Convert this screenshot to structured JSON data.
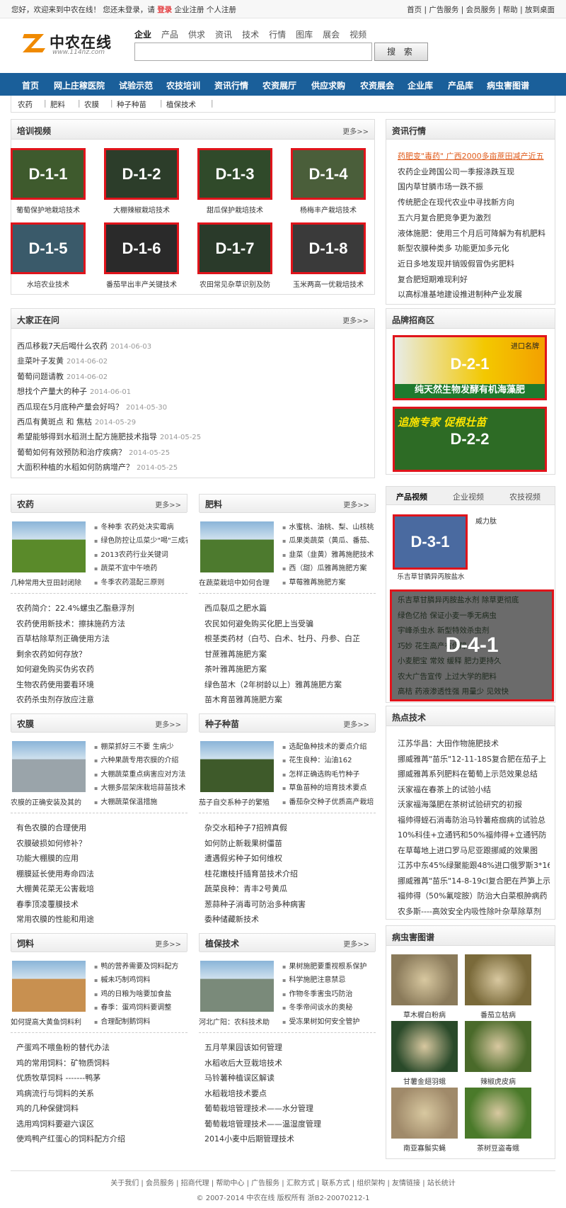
{
  "topbar": {
    "welcome": "您好，欢迎来到中农在线！ 您还未登录，请",
    "login": "登录",
    "links_left": "企业注册  个人注册",
    "links_right": "首页 | 广告服务 | 会员服务 | 帮助 | 放到桌面"
  },
  "logo": {
    "name": "中农在线",
    "url": "www.114nz.com"
  },
  "search": {
    "tabs": [
      "企业",
      "产品",
      "供求",
      "资讯",
      "技术",
      "行情",
      "图库",
      "展会",
      "视频"
    ],
    "value": "",
    "button": "搜 索"
  },
  "nav": [
    "首页",
    "网上庄稼医院",
    "试验示范",
    "农技培训",
    "资讯行情",
    "农资展厅",
    "供应求购",
    "农资展会",
    "企业库",
    "产品库",
    "病虫害图谱"
  ],
  "subnav": [
    "农药",
    "|",
    "肥料",
    "|",
    "农膜",
    "|",
    "种子种苗",
    "|",
    "植保技术",
    "|"
  ],
  "more": "更多>>",
  "training": {
    "title": "培训视频",
    "items": [
      {
        "label": "D-1-1",
        "caption": "葡萄保护地栽培技术"
      },
      {
        "label": "D-1-2",
        "caption": "大棚辣椒栽培技术"
      },
      {
        "label": "D-1-3",
        "caption": "甜瓜保护栽培技术"
      },
      {
        "label": "D-1-4",
        "caption": "杨梅丰产栽培技术"
      },
      {
        "label": "D-1-5",
        "caption": "水培农业技术"
      },
      {
        "label": "D-1-6",
        "caption": "番茄早出丰产关键技术"
      },
      {
        "label": "D-1-7",
        "caption": "农田常见杂草识别及防"
      },
      {
        "label": "D-1-8",
        "caption": "玉米两高一优栽培技术"
      }
    ]
  },
  "news": {
    "title": "资讯行情",
    "items": [
      "药肥变\"毒药\" 广西2000多亩蔗田减产近五",
      "农药企业跨国公司一季报涤跌互现",
      "国内草甘膦市场一跌不振",
      "传统肥企在现代农业中寻找新方向",
      "五六月复合肥竞争更为激烈",
      "液体施肥：使用三个月后可降解为有机肥料",
      "新型农膜种类多 功能更加多元化",
      "近日多地发现并销毁假冒伪劣肥料",
      "复合肥短期难现利好",
      "以高标准基地建设推进制种产业发展"
    ]
  },
  "asking": {
    "title": "大家正在问",
    "items": [
      {
        "q": "西瓜移栽7天后喝什么农药",
        "d": "2014-06-03"
      },
      {
        "q": "韭菜叶子发黄",
        "d": "2014-06-02"
      },
      {
        "q": "葡萄问题请教",
        "d": "2014-06-02"
      },
      {
        "q": "想找个产量大的种子",
        "d": "2014-06-01"
      },
      {
        "q": "西瓜现在5月底种产量会好吗？",
        "d": "2014-05-30"
      },
      {
        "q": "西瓜有黄斑点 和 焦枯",
        "d": "2014-05-29"
      },
      {
        "q": "希望能够得到水稻测土配方施肥技术指导",
        "d": "2014-05-25"
      },
      {
        "q": "葡萄如何有效预防和治疗疾病？",
        "d": "2014-05-25"
      },
      {
        "q": "大面积种植的水稻如何防病增产？",
        "d": "2014-05-25"
      }
    ]
  },
  "brand": {
    "title": "品牌招商区",
    "ads": [
      {
        "label": "D-2-1",
        "text": "纯天然生物发酵有机海藻肥",
        "tag": "进口名牌"
      },
      {
        "label": "D-2-2",
        "text": "追施专家 促根壮苗"
      }
    ]
  },
  "product_video": {
    "tabs": [
      "产品视频",
      "企业视频",
      "农技视频"
    ],
    "thumb": {
      "label": "D-3-1",
      "caption": "乐吉草甘膦异丙胺盐水",
      "side": "威力肽"
    },
    "list": {
      "label": "D-4-1",
      "items": [
        "乐吉草甘膦异丙胺盐水剂 除草更彻底",
        "绿色亿拾 保证小麦一季无病虫",
        "宇峰杀虫水 新型特效杀虫剂",
        "巧妙 花生高产有保障",
        "小麦肥宝 常效 缓释 肥力更持久",
        "农大广告宣传 上过大学的肥料",
        "高桔 药液渗透性强 用量少 见效快"
      ]
    }
  },
  "pesticide": {
    "title": "农药",
    "img_caption": "几种常用大豆田封闭除",
    "bullets": [
      "冬种季 农药处决实霉病",
      "绿色防控让瓜菜少\"喝\"三成农",
      "2013农药行业关键词",
      "蔬菜不宜中午喷药",
      "冬季农药混配三原则"
    ],
    "items": [
      "农药简介：22.4%螺虫乙酯悬浮剂",
      "农药使用新技术：擦抹施药方法",
      "百草枯除草剂正确使用方法",
      "剩余农药如何存放？",
      "如何避免购买伪劣农药",
      "生物农药使用要看环境",
      "农药杀虫剂存放应注意"
    ]
  },
  "fertilizer": {
    "title": "肥料",
    "img_caption": "在蔬菜栽培中如何合理",
    "bullets": [
      "水蜜桃、油桃、梨、山核桃",
      "瓜果类蔬菜（黄瓜、番茄、",
      "韭菜（韭黄）雅苒施肥技术",
      "西（甜）瓜雅苒施肥方案",
      "草莓雅苒施肥方案"
    ],
    "items": [
      "西瓜裂瓜之肥水篇",
      "农民如何避免购买化肥上当受骗",
      "根茎类药材（白芍、白术、牡丹、丹参、白芷",
      "甘蔗雅苒施肥方案",
      "茶叶雅苒施肥方案",
      "绿色苗木（2年树龄以上）雅苒施肥方案",
      "苗木育苗雅苒施肥方案"
    ]
  },
  "film": {
    "title": "农膜",
    "img_caption": "农膜的正确安装及其的",
    "bullets": [
      "棚菜抓好三不要 生病少",
      "六种果蔬专用农膜的介绍",
      "大棚蔬菜重点病害应对方法",
      "大棚多层架床栽培蒜苗技术",
      "大棚蔬菜保温措施"
    ],
    "items": [
      "有色农膜的合理使用",
      "农膜破损如何修补？",
      "功能大棚膜的应用",
      "棚膜延长使用寿命四法",
      "大棚黄花菜无公害栽培",
      "春季顶凌覆膜技术",
      "常用农膜的性能和用途"
    ]
  },
  "seed": {
    "title": "种子种苗",
    "img_caption": "茄子自交系种子的繁殖",
    "bullets": [
      "选配鱼种技术的要点介绍",
      "花生良种：汕油162",
      "怎样正确选购毛竹种子",
      "草鱼苗种的培育技术要点",
      "番茄杂交种子优质高产栽培"
    ],
    "items": [
      "杂交水稻种子7招辨真假",
      "如何防止新栽果树僵苗",
      "遭遇假劣种子如何维权",
      "桂花嫩枝扦插育苗技术介绍",
      "蔬菜良种：青丰2号黄瓜",
      "葱蒜种子消毒可防治多种病害",
      "委种储藏新技术"
    ]
  },
  "feed": {
    "title": "饲料",
    "img_caption": "如何提高大黄鱼饲料利",
    "bullets": [
      "鸭的营养需要及饲料配方",
      "槭未巧制鸡饲料",
      "鸡的日粮为啥要加食盐",
      "春季：蛋鸡饲料要调整",
      "合理配制鹅饲料"
    ],
    "items": [
      "产蛋鸡不喂鱼粉的替代办法",
      "鸡的常用饲料：矿物质饲料",
      "优质牧草饲料 -------鸭茅",
      "鸡病流行与饲料的关系",
      "鸡的几种保健饲料",
      "选用鸡饲料要避六误区",
      "使鸡鸭产红蛋心的饲料配方介绍"
    ]
  },
  "protection": {
    "title": "植保技术",
    "img_caption": "河北广阳：农科技术助",
    "bullets": [
      "果树施肥要重视根系保护",
      "科学施肥注意禁忌",
      "作物冬季害虫巧防治",
      "冬季帝间谈水的奥秘",
      "受冻果树如何安全管护"
    ],
    "items": [
      "五月苹果园该如何管理",
      "水稻收后大豆栽培技术",
      "马铃薯种植误区解读",
      "水稻栽培技术要点",
      "葡萄栽培管理技术——水分管理",
      "葡萄栽培管理技术——温湿度管理",
      "2014小麦中后期管理技术"
    ]
  },
  "hot_tech": {
    "title": "热点技术",
    "items": [
      "江苏华昌：大田作物施肥技术",
      "挪威雅苒\"苗乐\"12-11-18S复合肥在茄子上",
      "挪威雅苒系列肥料在葡萄上示范效果总结",
      "沃家福在春茶上的试验小结",
      "沃家福海藻肥在茶树试验研究的初报",
      "福帅得蛭石消毒防治马铃薯疮痂病的试验总",
      "10%科佳+立通钙和50%福帅得+立通钙防",
      "在草莓地上进口罗马尼亚跟挪威的效果图",
      "江苏中东45%绿聚能跟48%进口俄罗斯3*16",
      "挪威雅苒\"苗乐\"14-8-19cl复合肥在芦笋上示",
      "福帅得（50%氟啶胺）防治大白菜根肿病药",
      "农多斯----高效安全内吸性除叶杂草除草剂"
    ]
  },
  "pests": {
    "title": "病虫害图谱",
    "items": [
      {
        "name": "草木樨白粉病"
      },
      {
        "name": "番茄立枯病"
      },
      {
        "name": "甘薯金翅羽蛾"
      },
      {
        "name": "辣椒虎皮病"
      },
      {
        "name": "南亚寡鬃实蝇"
      },
      {
        "name": "茶树豆盗毒蛾"
      }
    ]
  },
  "footer": {
    "links": "关于我们 | 会员服务 | 招商代理 | 帮助中心 | 广告服务 | 汇款方式 | 联系方式 | 组织架构 | 友情链接 | 站长统计",
    "copyright": "© 2007-2014 中农在线 版权所有 浙B2-20070212-1"
  },
  "colors": {
    "nav_bg": "#1a5f9a",
    "accent_red": "#e0141b",
    "news_highlight": "#e05a1a"
  }
}
